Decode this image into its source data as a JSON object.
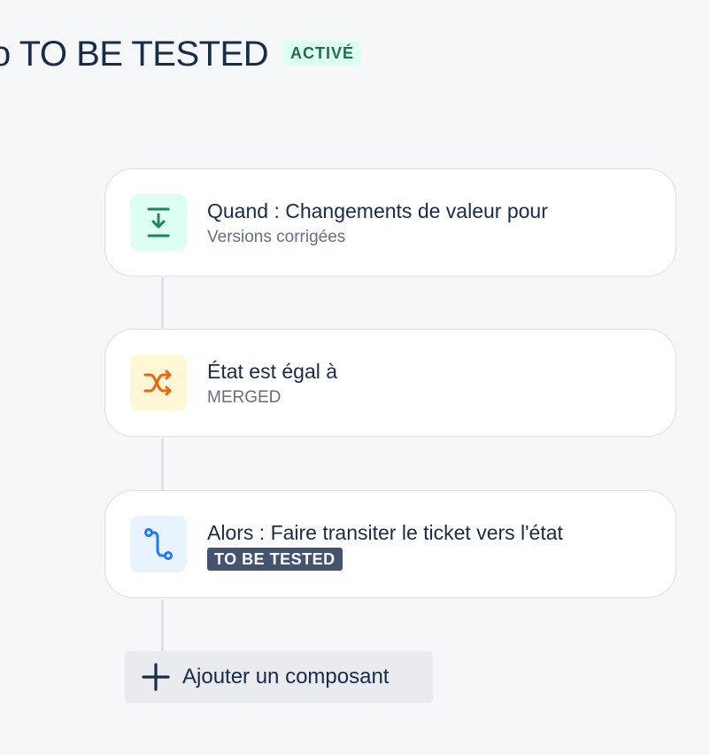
{
  "header": {
    "title": "o TO BE TESTED",
    "status_badge": "ACTIVÉ"
  },
  "rule_components": [
    {
      "type": "trigger",
      "icon": "download-icon",
      "title": "Quand : Changements de valeur pour",
      "subtitle": "Versions corrigées",
      "icon_bg": "#dcfff1",
      "icon_color": "#1f845a"
    },
    {
      "type": "condition",
      "icon": "shuffle-icon",
      "title": "État est égal à",
      "subtitle": "MERGED",
      "icon_bg": "#fff7d6",
      "icon_color": "#e56910"
    },
    {
      "type": "action",
      "icon": "route-icon",
      "title": "Alors : Faire transiter le ticket vers l'état",
      "lozenge": "TO BE TESTED",
      "icon_bg": "#e9f2ff",
      "icon_color": "#1d7afc"
    }
  ],
  "add_component_label": "Ajouter un composant"
}
